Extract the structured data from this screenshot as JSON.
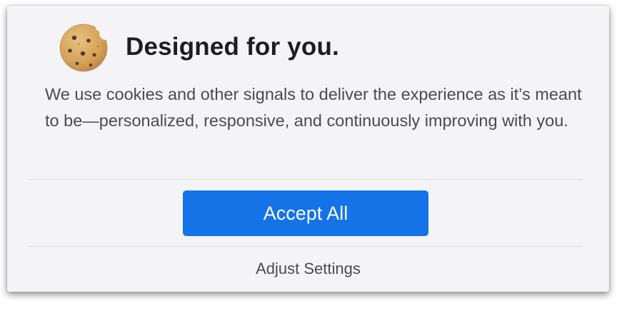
{
  "dialog": {
    "icon": "cookie-icon",
    "title": "Designed for you.",
    "message": "We use cookies and other signals to deliver the experience as it’s meant to be—personalized, responsive, and continuously improving with you.",
    "accept_label": "Accept All",
    "adjust_label": "Adjust Settings"
  },
  "colors": {
    "accent": "#1473e6",
    "background": "#f4f4f6",
    "title": "#1e1e22",
    "body_text": "#4a4a52"
  }
}
